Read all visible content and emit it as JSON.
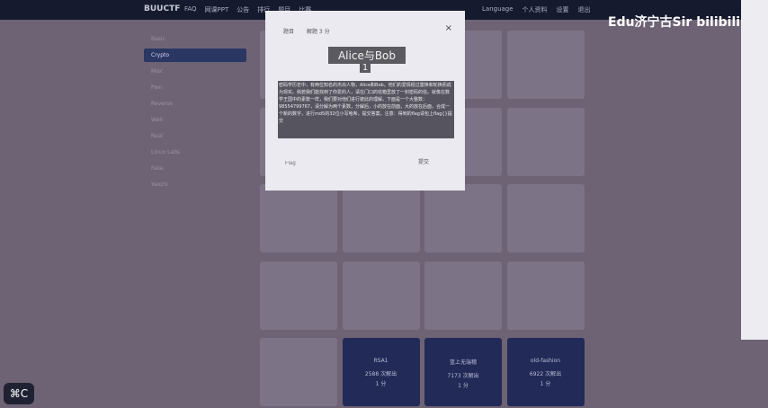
{
  "navbar": {
    "brand": "BUUCTF",
    "links": [
      "FAQ",
      "网课PPT",
      "公告",
      "排行",
      "题目",
      "比赛"
    ],
    "right": [
      "Language",
      "个人资料",
      "设置",
      "退出"
    ]
  },
  "sidebar": {
    "items": [
      {
        "label": "Basic"
      },
      {
        "label": "Crypto"
      },
      {
        "label": "Misc"
      },
      {
        "label": "Pwn"
      },
      {
        "label": "Reverse"
      },
      {
        "label": "Web"
      },
      {
        "label": "Real"
      },
      {
        "label": "Linux Labs"
      },
      {
        "label": "Fake"
      },
      {
        "label": "Yaozhi"
      }
    ]
  },
  "cards": [
    {
      "name": "",
      "count": "",
      "pts": "",
      "solved": false
    },
    {
      "name": "",
      "count": "",
      "pts": "",
      "solved": false
    },
    {
      "name": "",
      "count": "",
      "pts": "",
      "solved": false
    },
    {
      "name": "",
      "count": "",
      "pts": "",
      "solved": false
    },
    {
      "name": "",
      "count": "",
      "pts": "",
      "solved": false
    },
    {
      "name": "",
      "count": "",
      "pts": "",
      "solved": false
    },
    {
      "name": "",
      "count": "",
      "pts": "",
      "solved": false
    },
    {
      "name": "",
      "count": "",
      "pts": "",
      "solved": false
    },
    {
      "name": "",
      "count": "",
      "pts": "",
      "solved": false
    },
    {
      "name": "",
      "count": "",
      "pts": "",
      "solved": false
    },
    {
      "name": "",
      "count": "",
      "pts": "",
      "solved": false
    },
    {
      "name": "",
      "count": "",
      "pts": "",
      "solved": false
    },
    {
      "name": "",
      "count": "",
      "pts": "",
      "solved": false
    },
    {
      "name": "",
      "count": "",
      "pts": "",
      "solved": false
    },
    {
      "name": "",
      "count": "",
      "pts": "",
      "solved": false
    },
    {
      "name": "",
      "count": "",
      "pts": "",
      "solved": false
    },
    {
      "name": "",
      "count": "",
      "pts": "",
      "solved": false
    },
    {
      "name": "RSA1",
      "count": "2588 次解出",
      "pts": "1 分",
      "solved": true
    },
    {
      "name": "篮上无端穗",
      "count": "7173 次解出",
      "pts": "1 分",
      "solved": true
    },
    {
      "name": "old-fashion",
      "count": "6922 次解出",
      "pts": "1 分",
      "solved": true
    }
  ],
  "modal": {
    "tabs": [
      "题目",
      "解题 3 分"
    ],
    "title": "Alice与Bob",
    "points": "1",
    "description": "密码学历史中，有两位知名的杰出人物，Alice和Bob。他们的爱情经过置换和轮换而成为现实。倘若我们能找到了你爱的人，请在门口的信箱里放了一封密码的信。就像在数学王国中的素数一样，我们要对他们进行彼此的理解。下面是一个大整数：98554799767，请分解为两个素数，分解后，小的放在前面，大的放在后面，合成一个新的数字，进行md5的32位小写哈希，提交答案。注意：得到的flag请包上flag{}提交",
    "flag_placeholder": "Flag",
    "submit_label": "提交"
  },
  "watermark": "Edu济宁古Sir bilibili",
  "cmd_button": "⌘C"
}
